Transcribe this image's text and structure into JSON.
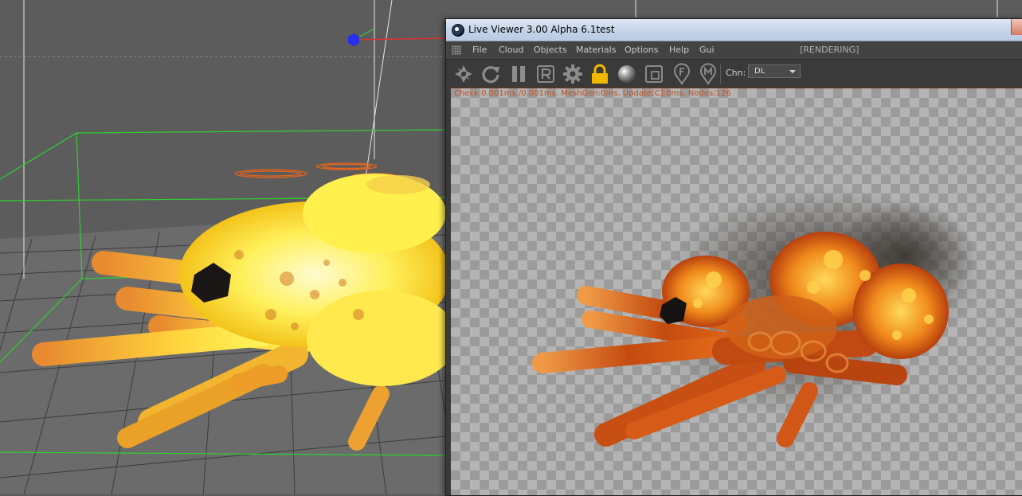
{
  "window": {
    "title": "Live Viewer 3.00 Alpha 6.1test"
  },
  "menu": {
    "items": [
      "File",
      "Cloud",
      "Objects",
      "Materials",
      "Options",
      "Help",
      "Gui"
    ],
    "status": "[RENDERING]"
  },
  "toolbar": {
    "icons": [
      "aperture-icon",
      "refresh-icon",
      "pause-icon",
      "r-letter-icon",
      "gear-icon",
      "lock-icon",
      "sphere-material-icon",
      "region-icon",
      "pin-f-icon",
      "pin-m-icon"
    ],
    "channel_label": "Chn:",
    "channel_value": "DL"
  },
  "render": {
    "stats": "Check:0.001ms./0.001ms. MeshGen:0ms. Update[C]:0ms. Nodes:126"
  },
  "colors": {
    "accent_stats": "#c0501d",
    "viewport_grid_green": "#2fd12f",
    "fire_yellow": "#ffea3a",
    "fire_orange": "#e8711c"
  }
}
